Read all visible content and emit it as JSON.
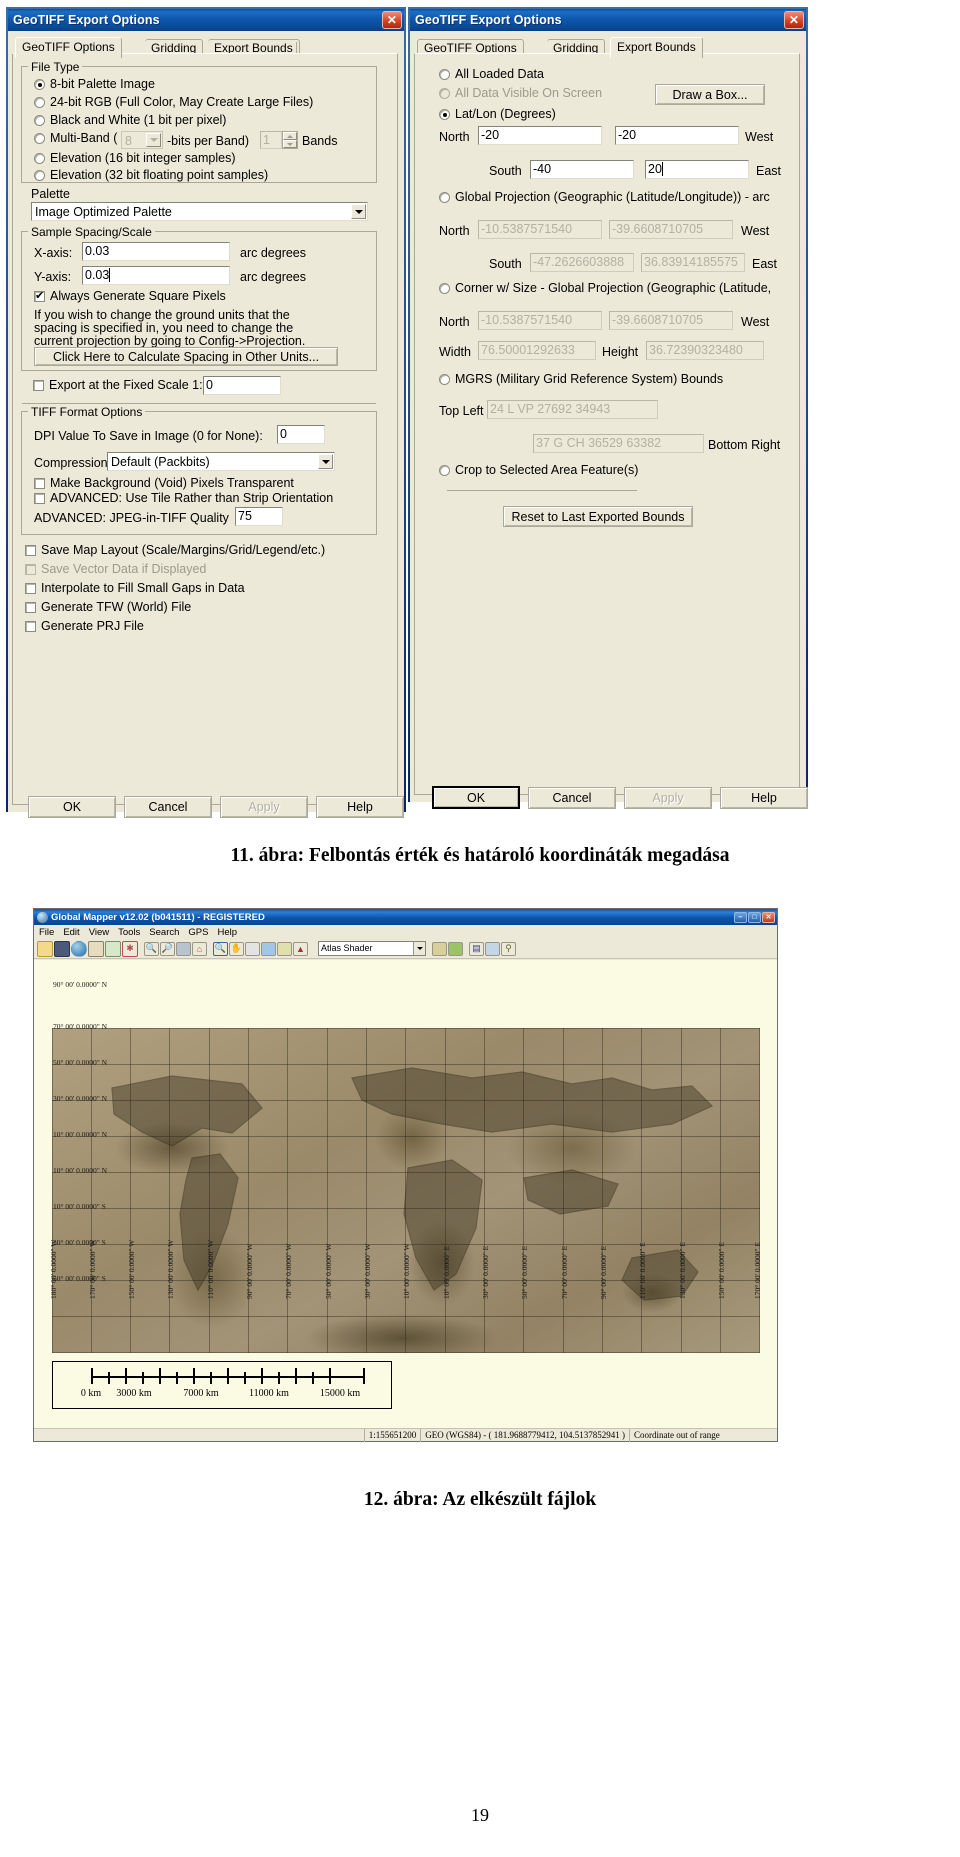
{
  "left_dialog": {
    "title": "GeoTIFF Export Options",
    "close_icon": "close-icon",
    "tabs": [
      {
        "label": "GeoTIFF Options",
        "selected": true
      },
      {
        "label": "Gridding",
        "selected": false
      },
      {
        "label": "Export Bounds",
        "selected": false
      }
    ],
    "file_type": {
      "group_label": "File Type",
      "options": [
        {
          "label": "8-bit Palette Image",
          "selected": true,
          "disabled": false
        },
        {
          "label": "24-bit RGB (Full Color, May Create Large Files)",
          "selected": false,
          "disabled": false
        },
        {
          "label": "Black and White (1 bit per pixel)",
          "selected": false,
          "disabled": false
        },
        {
          "label": "Multi-Band (",
          "selected": false,
          "disabled": false
        },
        {
          "label": "Elevation (16 bit integer samples)",
          "selected": false,
          "disabled": false
        },
        {
          "label": "Elevation (32 bit floating point samples)",
          "selected": false,
          "disabled": false
        }
      ],
      "multiband_bits_value": "8",
      "multiband_mid_label": "-bits per Band)",
      "multiband_bands_value": "1",
      "multiband_bands_label": "Bands"
    },
    "palette": {
      "label": "Palette",
      "value": "Image Optimized Palette"
    },
    "sample_spacing": {
      "group_label": "Sample Spacing/Scale",
      "x_label": "X-axis:",
      "x_value": "0.03",
      "x_units": "arc degrees",
      "y_label": "Y-axis:",
      "y_value": "0.03",
      "y_units": "arc degrees",
      "square_pixels_label": "Always Generate Square Pixels",
      "square_pixels_checked": true,
      "hint_line1": "If you wish to change the ground units that the",
      "hint_line2": "spacing is specified in, you need to change the",
      "hint_line3": "current projection by going to Config->Projection.",
      "calc_button": "Click Here to Calculate Spacing in Other Units...",
      "fixed_scale_label": "Export at the Fixed Scale 1:",
      "fixed_scale_checked": false,
      "fixed_scale_value": "0"
    },
    "tiff_format": {
      "group_label": "TIFF Format Options",
      "dpi_label": "DPI Value To Save in Image (0 for None):",
      "dpi_value": "0",
      "compression_label": "Compression:",
      "compression_value": "Default (Packbits)",
      "transparent_label": "Make Background (Void) Pixels Transparent",
      "transparent_checked": false,
      "tile_label": "ADVANCED: Use Tile Rather than Strip Orientation",
      "tile_checked": false,
      "jpeg_quality_label": "ADVANCED: JPEG-in-TIFF Quality",
      "jpeg_quality_value": "75"
    },
    "bottom_checks": [
      {
        "label": "Save Map Layout (Scale/Margins/Grid/Legend/etc.)",
        "checked": false,
        "disabled": false
      },
      {
        "label": "Save Vector Data if Displayed",
        "checked": false,
        "disabled": true
      },
      {
        "label": "Interpolate to Fill Small Gaps in Data",
        "checked": false,
        "disabled": false
      },
      {
        "label": "Generate TFW (World) File",
        "checked": false,
        "disabled": false
      },
      {
        "label": "Generate PRJ File",
        "checked": false,
        "disabled": false
      }
    ],
    "buttons": [
      {
        "label": "OK",
        "disabled": false,
        "default": false
      },
      {
        "label": "Cancel",
        "disabled": false,
        "default": false
      },
      {
        "label": "Apply",
        "disabled": true,
        "default": false
      },
      {
        "label": "Help",
        "disabled": false,
        "default": false
      }
    ]
  },
  "right_dialog": {
    "title": "GeoTIFF Export Options",
    "close_icon": "close-icon",
    "tabs": [
      {
        "label": "GeoTIFF Options",
        "selected": false
      },
      {
        "label": "Gridding",
        "selected": false
      },
      {
        "label": "Export Bounds",
        "selected": true
      }
    ],
    "draw_box_button": "Draw a Box...",
    "reset_button": "Reset to Last Exported Bounds",
    "modes": {
      "all_loaded": {
        "label": "All Loaded Data",
        "selected": false,
        "disabled": false
      },
      "all_visible": {
        "label": "All Data Visible On Screen",
        "selected": false,
        "disabled": true
      },
      "latlon": {
        "label": "Lat/Lon (Degrees)",
        "selected": true,
        "disabled": false,
        "north_label": "North",
        "north_value": "-20",
        "west_label": "West",
        "west_value": "-20",
        "south_label": "South",
        "south_value": "-40",
        "east_label": "East",
        "east_value": "20"
      },
      "global_projection": {
        "label": "Global Projection (Geographic (Latitude/Longitude)) - arc",
        "selected": false,
        "disabled": false,
        "north_label": "North",
        "north_value": "-10.5387571540",
        "west_label": "West",
        "west_value": "-39.6608710705",
        "south_label": "South",
        "south_value": "-47.2626603888",
        "east_label": "East",
        "east_value": "36.83914185575"
      },
      "corner_size": {
        "label": "Corner w/ Size - Global Projection (Geographic (Latitude,",
        "selected": false,
        "disabled": false,
        "north_label": "North",
        "north_value": "-10.5387571540",
        "west_label": "West",
        "west_value": "-39.6608710705",
        "width_label": "Width",
        "width_value": "76.50001292633",
        "height_label": "Height",
        "height_value": "36.72390323480"
      },
      "mgrs": {
        "label": "MGRS (Military Grid Reference System) Bounds",
        "selected": false,
        "disabled": false,
        "topleft_label": "Top Left",
        "topleft_value": "24 L VP 27692 34943",
        "bottomright_label": "Bottom Right",
        "bottomright_value": "37 G CH 36529 63382"
      },
      "crop": {
        "label": "Crop to Selected Area Feature(s)",
        "selected": false,
        "disabled": false
      }
    },
    "buttons": [
      {
        "label": "OK",
        "disabled": false,
        "default": true
      },
      {
        "label": "Cancel",
        "disabled": false,
        "default": false
      },
      {
        "label": "Apply",
        "disabled": true,
        "default": false
      },
      {
        "label": "Help",
        "disabled": false,
        "default": false
      }
    ]
  },
  "figure11_caption_prefix": "11. ábra:",
  "figure11_caption_text": "Felbontás érték és határoló koordináták megadása",
  "figure12_caption_prefix": "12. ábra:",
  "figure12_caption_text": "Az elkészült fájlok",
  "page_number": "19",
  "global_mapper": {
    "title": "Global Mapper v12.02 (b041511) - REGISTERED",
    "app_icon": "globe-icon",
    "window_buttons": [
      "minimize-icon",
      "maximize-icon",
      "close-icon"
    ],
    "menus": [
      "File",
      "Edit",
      "View",
      "Tools",
      "Search",
      "GPS",
      "Help"
    ],
    "toolbar_icons": [
      "open-folder-icon",
      "save-icon",
      "globe-icon",
      "layers-icon",
      "overlay-control-icon",
      "sun-shader-icon",
      "zoom-in-icon",
      "zoom-out-icon",
      "zoom-to-selection-icon",
      "zoom-full-icon",
      "pan-zoom-icon",
      "grab-pan-icon",
      "measure-icon",
      "feature-info-icon",
      "digitizer-icon",
      "path-profile-icon"
    ],
    "shader_combo_value": "Atlas Shader",
    "toolbar_icons_right": [
      "shader-options-icon",
      "elevation-legend-icon",
      "grid-icon",
      "vector-icon",
      "pin-icon"
    ],
    "map": {
      "lat_labels": [
        "90° 00' 0.0000\" N",
        "70° 00' 0.0000\" N",
        "50° 00' 0.0000\" N",
        "30° 00' 0.0000\" N",
        "10° 00' 0.0000\" N",
        "10° 00' 0.0000\" N",
        "10° 00' 0.0000\" S",
        "30° 00' 0.0000\" S",
        "50° 00' 0.0000\" S"
      ],
      "lon_labels": [
        "180° 00' 0.0000\" W",
        "170° 00' 0.0000\" W",
        "150° 00' 0.0000\" W",
        "130° 00' 0.0000\" W",
        "110° 00' 0.0000\" W",
        "90° 00' 0.0000\" W",
        "70° 00' 0.0000\" W",
        "50° 00' 0.0000\" W",
        "30° 00' 0.0000\" W",
        "10° 00' 0.0000\" W",
        "10° 00' 0.0000\" E",
        "30° 00' 0.0000\" E",
        "50° 00' 0.0000\" E",
        "70° 00' 0.0000\" E",
        "90° 00' 0.0000\" E",
        "110° 00' 0.0000\" E",
        "130° 00' 0.0000\" E",
        "150° 00' 0.0000\" E",
        "170° 00' 0.0000\" E"
      ]
    },
    "scale_bar": {
      "labels": [
        "0 km",
        "3000 km",
        "7000 km",
        "11000 km",
        "15000 km"
      ],
      "tick_count": 16
    },
    "status_bar": {
      "scale": "1:155651200",
      "projection": "GEO (WGS84) - ( 181.9688779412, 104.5137852941 )",
      "message": "Coordinate out of range"
    }
  }
}
